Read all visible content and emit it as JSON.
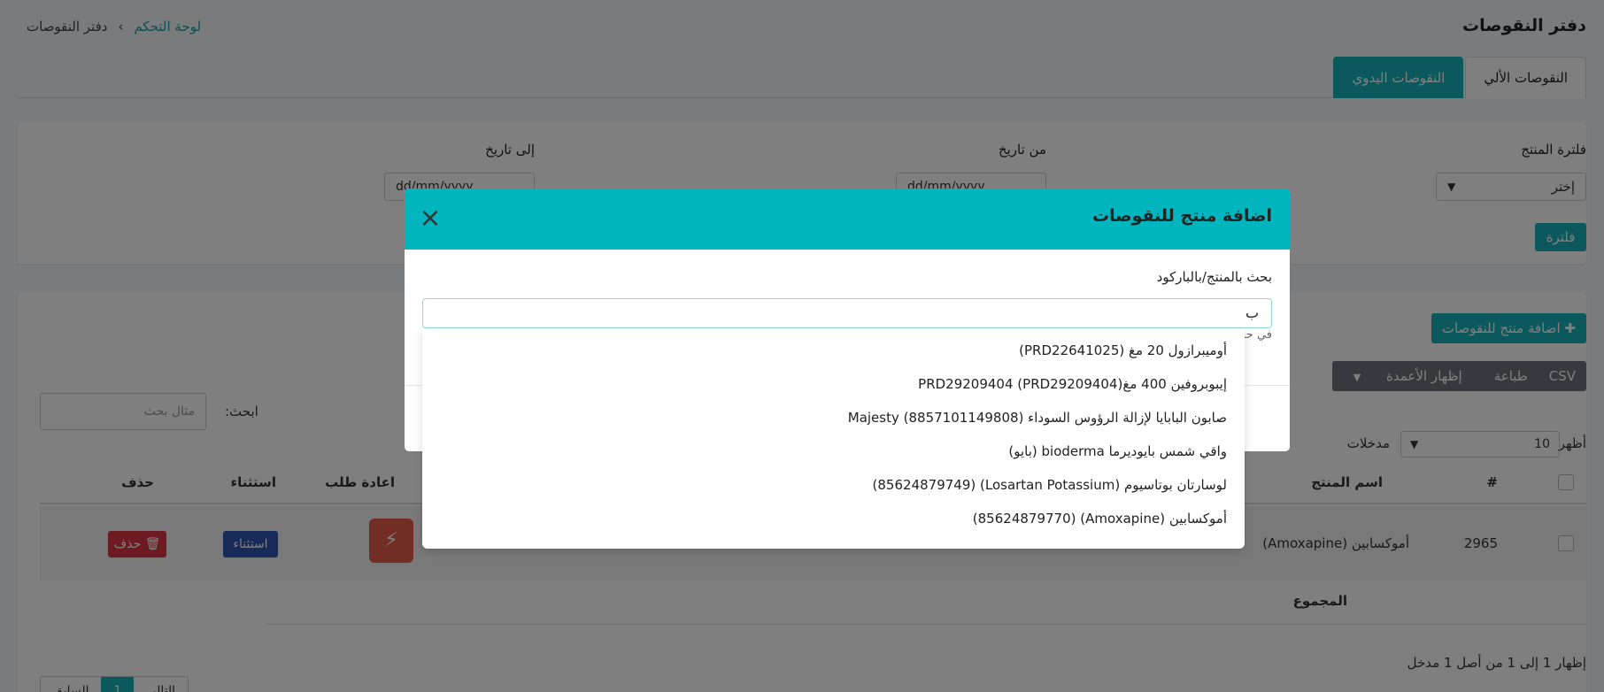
{
  "header": {
    "page_title": "دفتر النقوصات",
    "breadcrumb": {
      "home": "لوحة التحكم",
      "separator": "›",
      "current": "دفتر النقوصات"
    }
  },
  "tabs": [
    {
      "label": "النقوصات الألي",
      "active": false
    },
    {
      "label": "النقوصات اليدوي",
      "active": true
    }
  ],
  "filters": {
    "product_filter_label": "فلترة المنتج",
    "product_filter_value": "إختر",
    "from_date_label": "من تاريخ",
    "from_date_placeholder": "dd/mm/yyyy",
    "to_date_label": "إلى تاريخ",
    "to_date_placeholder": "dd/mm/yyyy",
    "filter_button": "فلترة"
  },
  "table_toolbar": {
    "add_button": "اضافة منتج للنقوصات",
    "export_buttons": [
      "CSV",
      "طباعة",
      "إظهار الأعمدة"
    ],
    "search_label": "ابحث:",
    "search_placeholder": "مثال بحث",
    "show_label": "أظهر",
    "entries_value": "10",
    "entries_suffix": "مدخلات"
  },
  "table": {
    "columns": [
      "#",
      "اسم المنتج",
      "اعادة طلب",
      "استثناء",
      "حذف"
    ],
    "rows": [
      {
        "id": "2965",
        "product": "أموكسابين (Amoxapine)",
        "exclude_button": "استثناء",
        "delete_button": "حذف"
      }
    ],
    "total_label": "المجموع",
    "info": "إظهار 1 إلى 1 من أصل 1 مدخل",
    "pagination": [
      "السابق",
      "1",
      "التالي"
    ]
  },
  "modal": {
    "title": "اضافة منتج للنقوصات",
    "field_label": "بحث بالمنتج/بالباركود",
    "search_value": "ب",
    "hint": "في حـ",
    "suggestions": [
      "أوميبرازول 20 مغ (PRD22641025)",
      "إيبوبروفين 400 مغ(PRD29209404 (PRD29209404",
      "صابون البابايا لإزالة الرؤوس السوداء (8857101149808) Majesty",
      "واقي شمس بايوديرما bioderma (بايو)",
      "لوسارتان بوتاسيوم (Losartan Potassium) (85624879749)",
      "أموكسابين (Amoxapine) (85624879770)"
    ]
  },
  "colors": {
    "accent": "#17b2b8",
    "modal_header": "#00b5bd",
    "danger": "#dc3545",
    "primary": "#2f55b5"
  }
}
